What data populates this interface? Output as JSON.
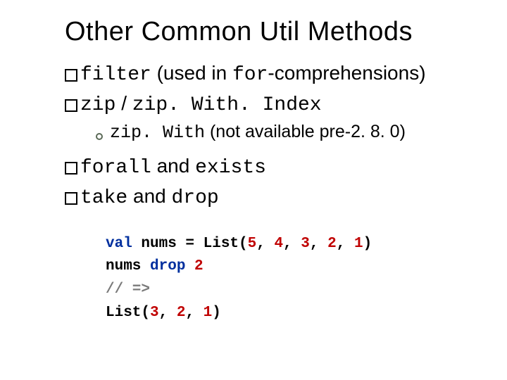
{
  "title": "Other Common Util Methods",
  "items": [
    {
      "code1": "filter",
      "rest": " (used in ",
      "code2": "for",
      "rest2": "-comprehensions)"
    },
    {
      "code1": "zip",
      "rest": " / ",
      "code2": "zip. With. Index",
      "sub": {
        "code": "zip. With",
        "rest": " (not available pre-2. 8. 0)"
      }
    },
    {
      "code1": "forall",
      "rest": " and ",
      "code2": "exists"
    },
    {
      "code1": "take",
      "rest": " and ",
      "code2": "drop"
    }
  ],
  "code": {
    "l1_kw": "val",
    "l1_a": " nums = List(",
    "l1_n1": "5",
    "l1_c": ", ",
    "l1_n2": "4",
    "l1_n3": "3",
    "l1_n4": "2",
    "l1_n5": "1",
    "l1_close": ")",
    "l2_a": "nums ",
    "l2_kw": "drop",
    "l2_sp": " ",
    "l2_n": "2",
    "l3": "// =>",
    "l4_a": "List(",
    "l4_n1": "3",
    "l4_c": ", ",
    "l4_n2": "2",
    "l4_n3": "1",
    "l4_close": ")"
  }
}
